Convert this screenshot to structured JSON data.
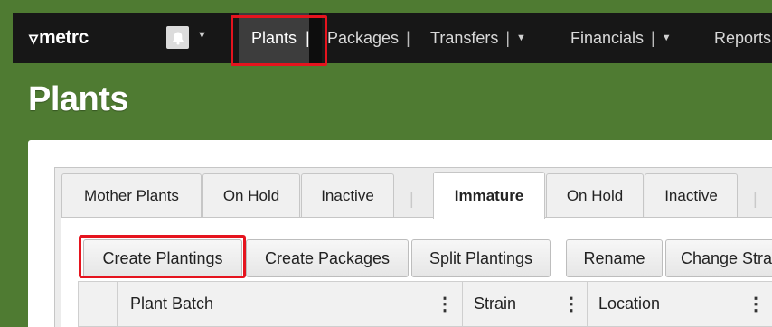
{
  "nav": {
    "logo": "metrc",
    "items": [
      {
        "label": "Plants",
        "active": true
      },
      {
        "label": "Packages"
      },
      {
        "label": "Transfers"
      },
      {
        "label": "Financials"
      },
      {
        "label": "Reports"
      }
    ],
    "separator": "|",
    "caret": "▼"
  },
  "page": {
    "title": "Plants"
  },
  "tabs": {
    "left": [
      "Mother Plants",
      "On Hold",
      "Inactive"
    ],
    "right": [
      "Immature",
      "On Hold",
      "Inactive"
    ],
    "separator": "|"
  },
  "toolbar": {
    "buttons": [
      "Create Plantings",
      "Create Packages",
      "Split Plantings",
      "Rename",
      "Change Stra"
    ]
  },
  "grid": {
    "columns": [
      "Plant Batch",
      "Strain",
      "Location"
    ],
    "kebab": "⋮"
  },
  "colors": {
    "background_green": "#4f7b32",
    "navbar": "#171717",
    "highlight": "#e5141e"
  }
}
